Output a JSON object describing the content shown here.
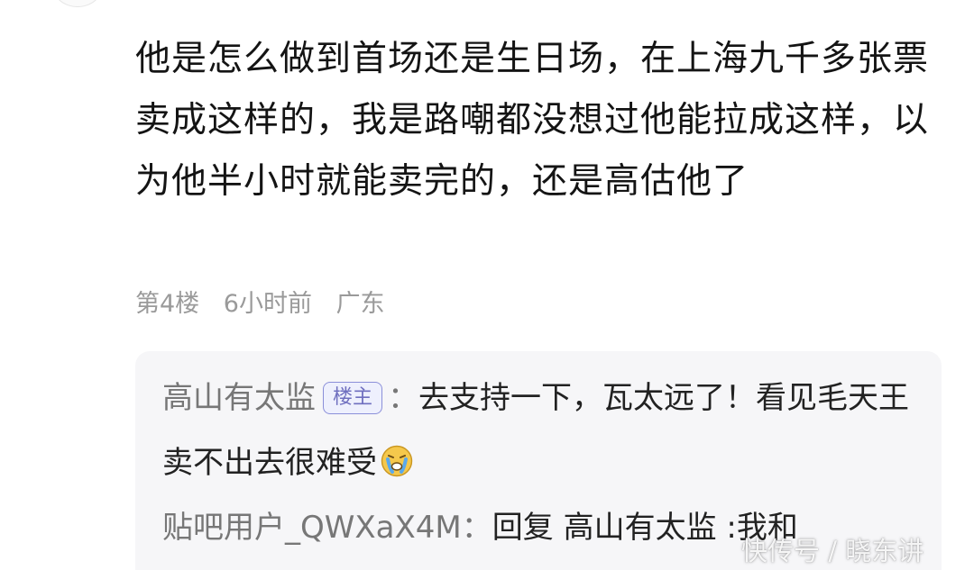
{
  "post": {
    "content": "他是怎么做到首场还是生日场，在上海九千多张票卖成这样的，我是路嘲都没想过他能拉成这样，以为他半小时就能卖完的，还是高估他了",
    "floor": "第4楼",
    "time": "6小时前",
    "location": "广东"
  },
  "replies": [
    {
      "author": "高山有太监",
      "badge": "楼主",
      "separator": "：",
      "text": "去支持一下，瓦太远了！看见毛天王卖不出去很难受",
      "emoji": "crying-face"
    },
    {
      "author": "贴吧用户_QWXaX4M",
      "separator": "：",
      "text": "回复 高山有太监 :我和"
    }
  ],
  "watermark": "快传号 / 晓东讲"
}
